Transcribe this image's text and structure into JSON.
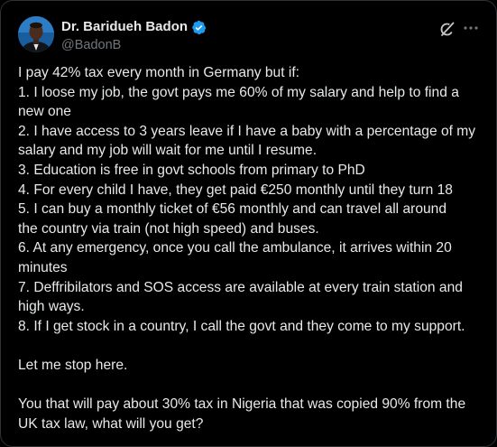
{
  "author": {
    "display_name": "Dr. Baridueh Badon",
    "handle": "@BadonB",
    "verified": true
  },
  "icons": {
    "verified": "verified-badge-icon",
    "grok": "grok-icon",
    "more": "more-options-icon",
    "verified_color": "#1d9bf0"
  },
  "tweet": {
    "lines": [
      "I pay 42% tax every month in Germany but if:",
      "1. I loose my job,  the govt pays me 60% of my salary and help to find a",
      "new one",
      "2. I have access to 3 years leave if I have a baby with a percentage of my",
      "salary and my job will wait for me until I resume.",
      "3. Education is free in govt schools from primary to PhD",
      "4. For every child I have, they get paid €250 monthly until they turn 18",
      "5. I can buy a monthly ticket of €56 monthly and can travel all around",
      "the country via train (not high speed) and buses.",
      "6. At any emergency,  once you call the ambulance,  it arrives within 20",
      "minutes",
      "7. Deffribilators and SOS access are available at every train station and",
      "high ways.",
      "8. If I get stock in a country, I call the govt and they come to my support.",
      "",
      "Let me stop here.",
      "",
      "You that will pay about 30% tax in Nigeria that was copied 90% from the",
      "UK tax law, what will you get?"
    ]
  }
}
